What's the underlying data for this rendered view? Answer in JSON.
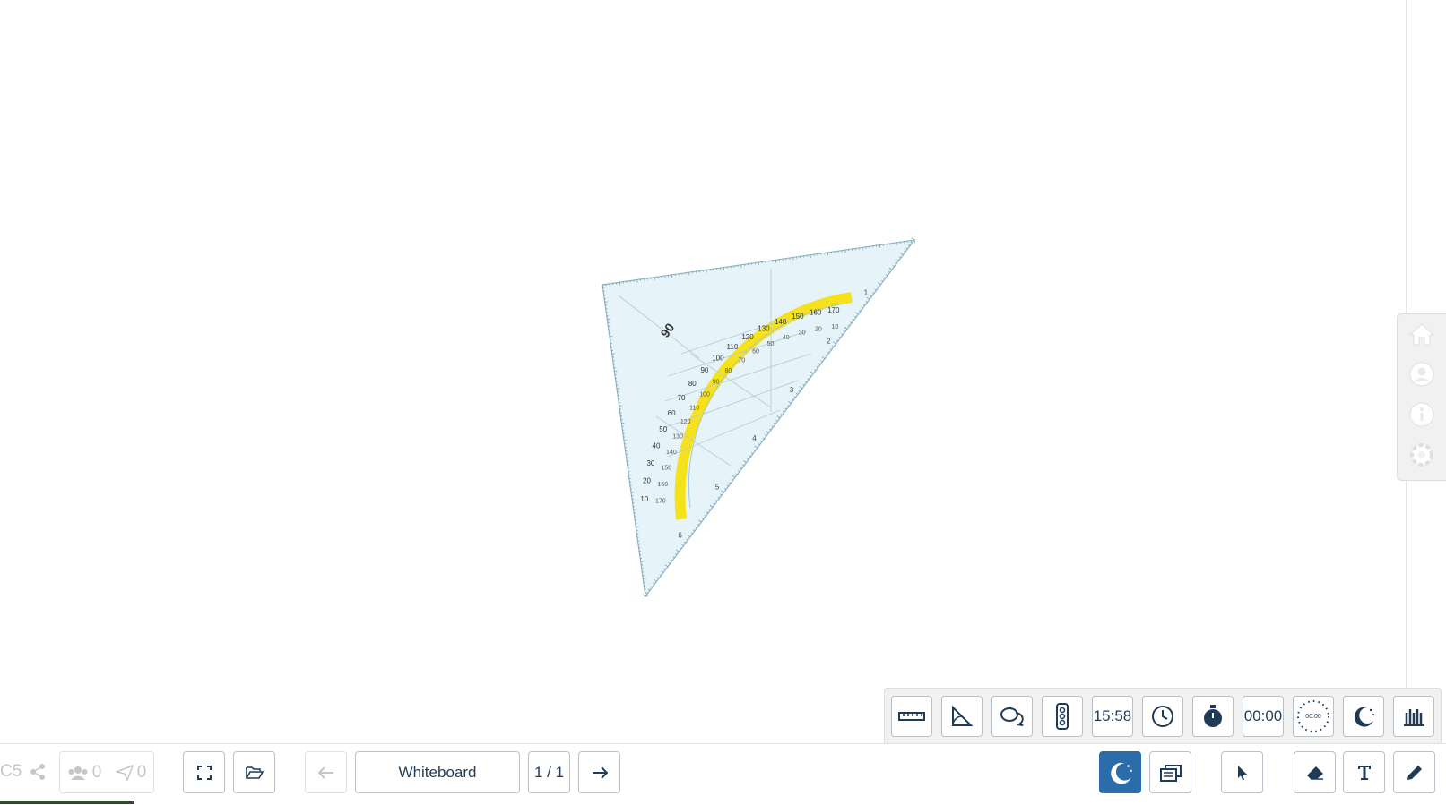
{
  "app": {
    "board_title": "Whiteboard",
    "page_indicator": "1 / 1",
    "room_code": "C5",
    "participants_count": "0",
    "messages_count": "0"
  },
  "palette": {
    "clock_time": "15:58",
    "stopwatch_time": "00:00",
    "random_timer_label": "00:00"
  },
  "setsquare": {
    "outer_scale": [
      "10",
      "20",
      "30",
      "40",
      "50",
      "60",
      "70",
      "80",
      "90",
      "100",
      "110",
      "120",
      "130",
      "140",
      "150",
      "160",
      "170"
    ],
    "inner_scale": [
      "170",
      "160",
      "150",
      "140",
      "130",
      "120",
      "110",
      "100",
      "90",
      "80",
      "70",
      "60",
      "50",
      "40",
      "30",
      "20",
      "10"
    ],
    "edge_numbers": [
      "1",
      "2",
      "3",
      "4",
      "5",
      "6"
    ]
  },
  "colors": {
    "accent": "#2b6cab",
    "icon": "#1f3b57",
    "protractor_band": "#f5e21b",
    "setsquare_fill": "#e6f4fa"
  }
}
